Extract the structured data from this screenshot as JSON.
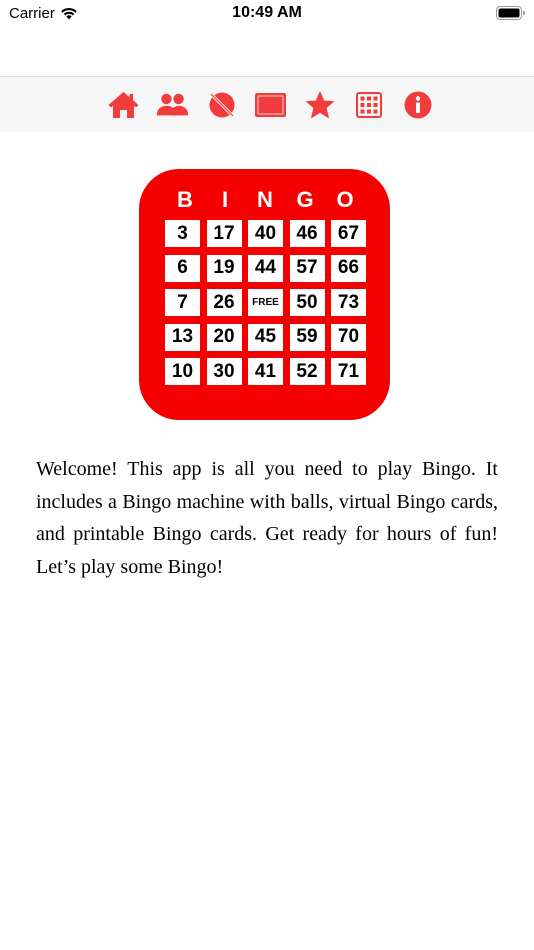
{
  "status_bar": {
    "carrier": "Carrier",
    "time": "10:49 AM"
  },
  "toolbar": {
    "accent_color": "#f23c3c",
    "items": [
      {
        "icon": "home-icon"
      },
      {
        "icon": "players-icon"
      },
      {
        "icon": "ball-off-icon"
      },
      {
        "icon": "screen-icon"
      },
      {
        "icon": "star-icon"
      },
      {
        "icon": "grid-icon"
      },
      {
        "icon": "info-icon"
      }
    ]
  },
  "bingo_card": {
    "color": "#f50000",
    "letters": [
      "B",
      "I",
      "N",
      "G",
      "O"
    ],
    "rows": [
      [
        "3",
        "17",
        "40",
        "46",
        "67"
      ],
      [
        "6",
        "19",
        "44",
        "57",
        "66"
      ],
      [
        "7",
        "26",
        "FREE",
        "50",
        "73"
      ],
      [
        "13",
        "20",
        "45",
        "59",
        "70"
      ],
      [
        "10",
        "30",
        "41",
        "52",
        "71"
      ]
    ]
  },
  "welcome_text": "Welcome! This app is all you need to play Bingo. It includes a Bingo machine with balls, virtual Bingo cards, and printable Bingo cards. Get ready for hours of fun! Let’s play some Bingo!"
}
